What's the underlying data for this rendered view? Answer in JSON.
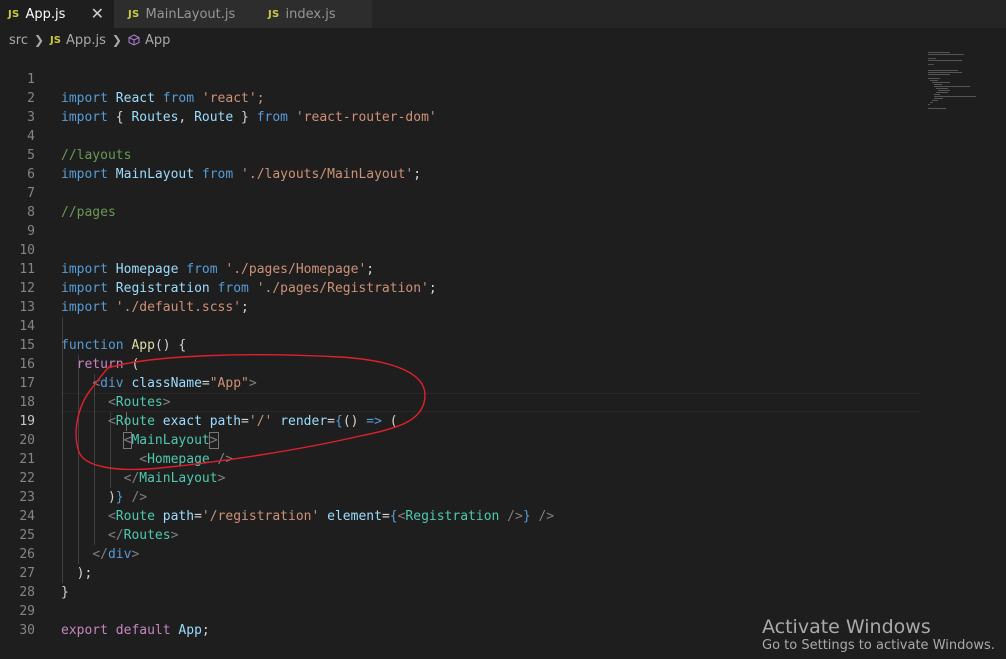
{
  "tabs": [
    {
      "badge": "JS",
      "label": "App.js",
      "active": true,
      "close": "✕"
    },
    {
      "badge": "JS",
      "label": "MainLayout.js",
      "active": false
    },
    {
      "badge": "JS",
      "label": "index.js",
      "active": false
    }
  ],
  "breadcrumb": {
    "folder": "src",
    "badge": "JS",
    "file": "App.js",
    "symbol": "App"
  },
  "editor": {
    "current_line": 19,
    "lines": [
      {
        "n": "1"
      },
      {
        "n": "2"
      },
      {
        "n": "3"
      },
      {
        "n": "4"
      },
      {
        "n": "5"
      },
      {
        "n": "6"
      },
      {
        "n": "7"
      },
      {
        "n": "8"
      },
      {
        "n": "9"
      },
      {
        "n": "10"
      },
      {
        "n": "11"
      },
      {
        "n": "12"
      },
      {
        "n": "13"
      },
      {
        "n": "14"
      },
      {
        "n": "15"
      },
      {
        "n": "16"
      },
      {
        "n": "17"
      },
      {
        "n": "18"
      },
      {
        "n": "19"
      },
      {
        "n": "20"
      },
      {
        "n": "21"
      },
      {
        "n": "22"
      },
      {
        "n": "23"
      },
      {
        "n": "24"
      },
      {
        "n": "25"
      },
      {
        "n": "26"
      },
      {
        "n": "27"
      },
      {
        "n": "28"
      },
      {
        "n": "29"
      },
      {
        "n": "30"
      }
    ],
    "code": {
      "l1_import": "import",
      "l1_name": "React",
      "l1_from": "from",
      "l1_src": "'react';",
      "l2_import": "import",
      "l2_open": "{ ",
      "l2_a": "Routes",
      "l2_comma": ", ",
      "l2_b": "Route",
      "l2_close": " }",
      "l2_from": "from",
      "l2_src": "'react-router-dom'",
      "l4_comment": "//layouts",
      "l5_import": "import",
      "l5_name": "MainLayout",
      "l5_from": "from",
      "l5_src": "'./layouts/MainLayout'",
      "l5_semi": ";",
      "l7_comment": "//pages",
      "l10_import": "import",
      "l10_name": "Homepage",
      "l10_from": "from",
      "l10_src": "'./pages/Homepage'",
      "l10_semi": ";",
      "l11_import": "import",
      "l11_name": "Registration",
      "l11_from": "from",
      "l11_src": "'./pages/Registration'",
      "l11_semi": ";",
      "l12_import": "import",
      "l12_src": "'./default.scss'",
      "l12_semi": ";",
      "l14_function": "function",
      "l14_name": "App",
      "l14_rest": "() {",
      "l15_return": "return",
      "l15_rest": " (",
      "l16_lt": "<",
      "l16_tag": "div",
      "l16_attr": "className",
      "l16_eq": "=",
      "l16_val": "\"App\"",
      "l16_gt": ">",
      "l17_lt": "<",
      "l17_tag": "Routes",
      "l17_gt": ">",
      "l18_lt": "<",
      "l18_tag": "Route",
      "l18_a1": "exact",
      "l18_a2": "path",
      "l18_eq": "=",
      "l18_val": "'/'",
      "l18_a3": "render",
      "l18_eq2": "=",
      "l18_brace": "{",
      "l18_arrowpre": "() ",
      "l18_arrow": "=>",
      "l18_paren": " (",
      "l19_lt": "<",
      "l19_tag": "MainLayout",
      "l19_gt": ">",
      "l20_lt": "<",
      "l20_tag": "Homepage",
      "l20_gt": " />",
      "l21_lt": "</",
      "l21_tag": "MainLayout",
      "l21_gt": ">",
      "l22_paren": ")",
      "l22_brace": "}",
      "l22_end": " />",
      "l23_lt": "<",
      "l23_tag": "Route",
      "l23_a1": "path",
      "l23_eq": "=",
      "l23_val": "'/registration'",
      "l23_a2": "element",
      "l23_eq2": "=",
      "l23_brace": "{",
      "l23_ilt": "<",
      "l23_itag": "Registration",
      "l23_igt": " />",
      "l23_brace2": "}",
      "l23_end": " />",
      "l24_lt": "</",
      "l24_tag": "Routes",
      "l24_gt": ">",
      "l25_lt": "</",
      "l25_tag": "div",
      "l25_gt": ">",
      "l26": ");",
      "l27": "}",
      "l29_export": "export",
      "l29_default": "default",
      "l29_name": "App",
      "l29_semi": ";"
    }
  },
  "watermark": {
    "title": "Activate Windows",
    "subtitle": "Go to Settings to activate Windows."
  },
  "colors": {
    "annotation": "#e0202a",
    "keyword": "#569cd6",
    "control": "#c586c0",
    "string": "#ce9178",
    "tag": "#4ec9b0"
  }
}
